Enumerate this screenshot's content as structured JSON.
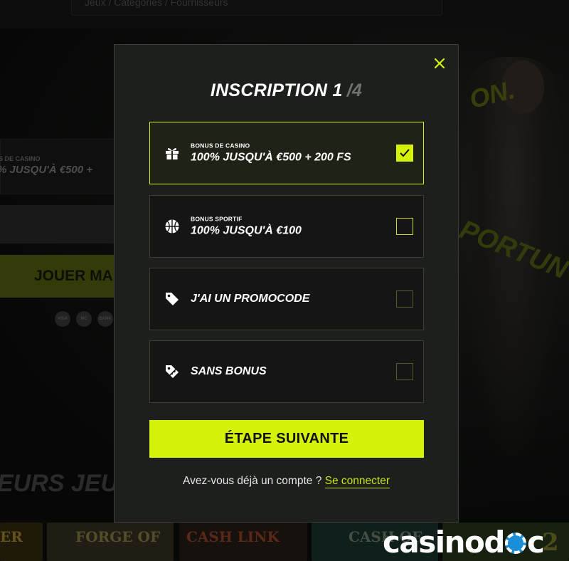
{
  "background": {
    "search_placeholder": "Jeux / Catégories / Fournisseurs",
    "hero_text_top": "ON.",
    "hero_text_bottom": "PORTUN",
    "bonus_label": "S DE CASINO",
    "bonus_value": "% JUSQU'À €500 +",
    "cta_label": "JOUER MA",
    "payment_icons": [
      "VISA",
      "MC",
      "BANK"
    ],
    "section_title": "EURS JEU",
    "games": [
      "ER",
      "FORGE OF",
      "CASH LINK",
      "CASH OF",
      "2"
    ]
  },
  "modal": {
    "title": "INSCRIPTION 1",
    "title_total": "/4",
    "close_icon": "close-icon",
    "accent": "#d4f20a",
    "options": [
      {
        "small": "BONUS DE CASINO",
        "main": "100% JUSQU'À €500 + 200 FS",
        "icon": "gift-icon",
        "selected": true
      },
      {
        "small": "BONUS SPORTIF",
        "main": "100% JUSQU'À €100",
        "icon": "basketball-icon",
        "selected": false
      },
      {
        "small": "",
        "main": "J'AI UN PROMOCODE",
        "icon": "tag-icon",
        "selected": false
      },
      {
        "small": "",
        "main": "SANS BONUS",
        "icon": "no-bonus-tag-icon",
        "selected": false
      }
    ],
    "next_button": "ÉTAPE SUIVANTE",
    "login_prompt": "Avez-vous déjà un compte ?",
    "login_link": "Se connecter"
  },
  "watermark": {
    "left": "casinod",
    "right": "c"
  }
}
